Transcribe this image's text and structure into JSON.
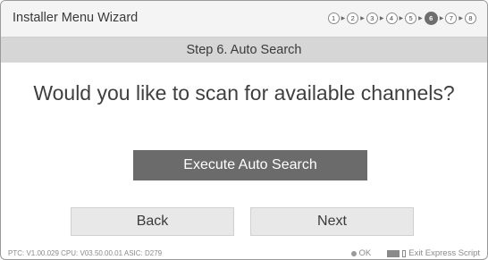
{
  "header": {
    "title": "Installer Menu Wizard",
    "steps": [
      "1",
      "2",
      "3",
      "4",
      "5",
      "6",
      "7",
      "8"
    ],
    "current_step": "6"
  },
  "step_bar": {
    "label": "Step 6. Auto Search"
  },
  "main": {
    "question": "Would you like to scan for available channels?",
    "execute_label": "Execute Auto Search"
  },
  "nav": {
    "back_label": "Back",
    "next_label": "Next"
  },
  "footer": {
    "info": "PTC:  V1.00.029 CPU: V03.50.00.01 ASIC: D279",
    "ok_label": "OK",
    "exit_label": "Exit Express Script"
  },
  "colors": {
    "step_bar_bg": "#d6d6d6",
    "execute_bg": "#6b6b6b",
    "nav_bg": "#e8e8e8"
  },
  "icons": [
    "step-arrow-icon",
    "ok-dot-icon",
    "keyboard-icon",
    "exit-icon"
  ]
}
